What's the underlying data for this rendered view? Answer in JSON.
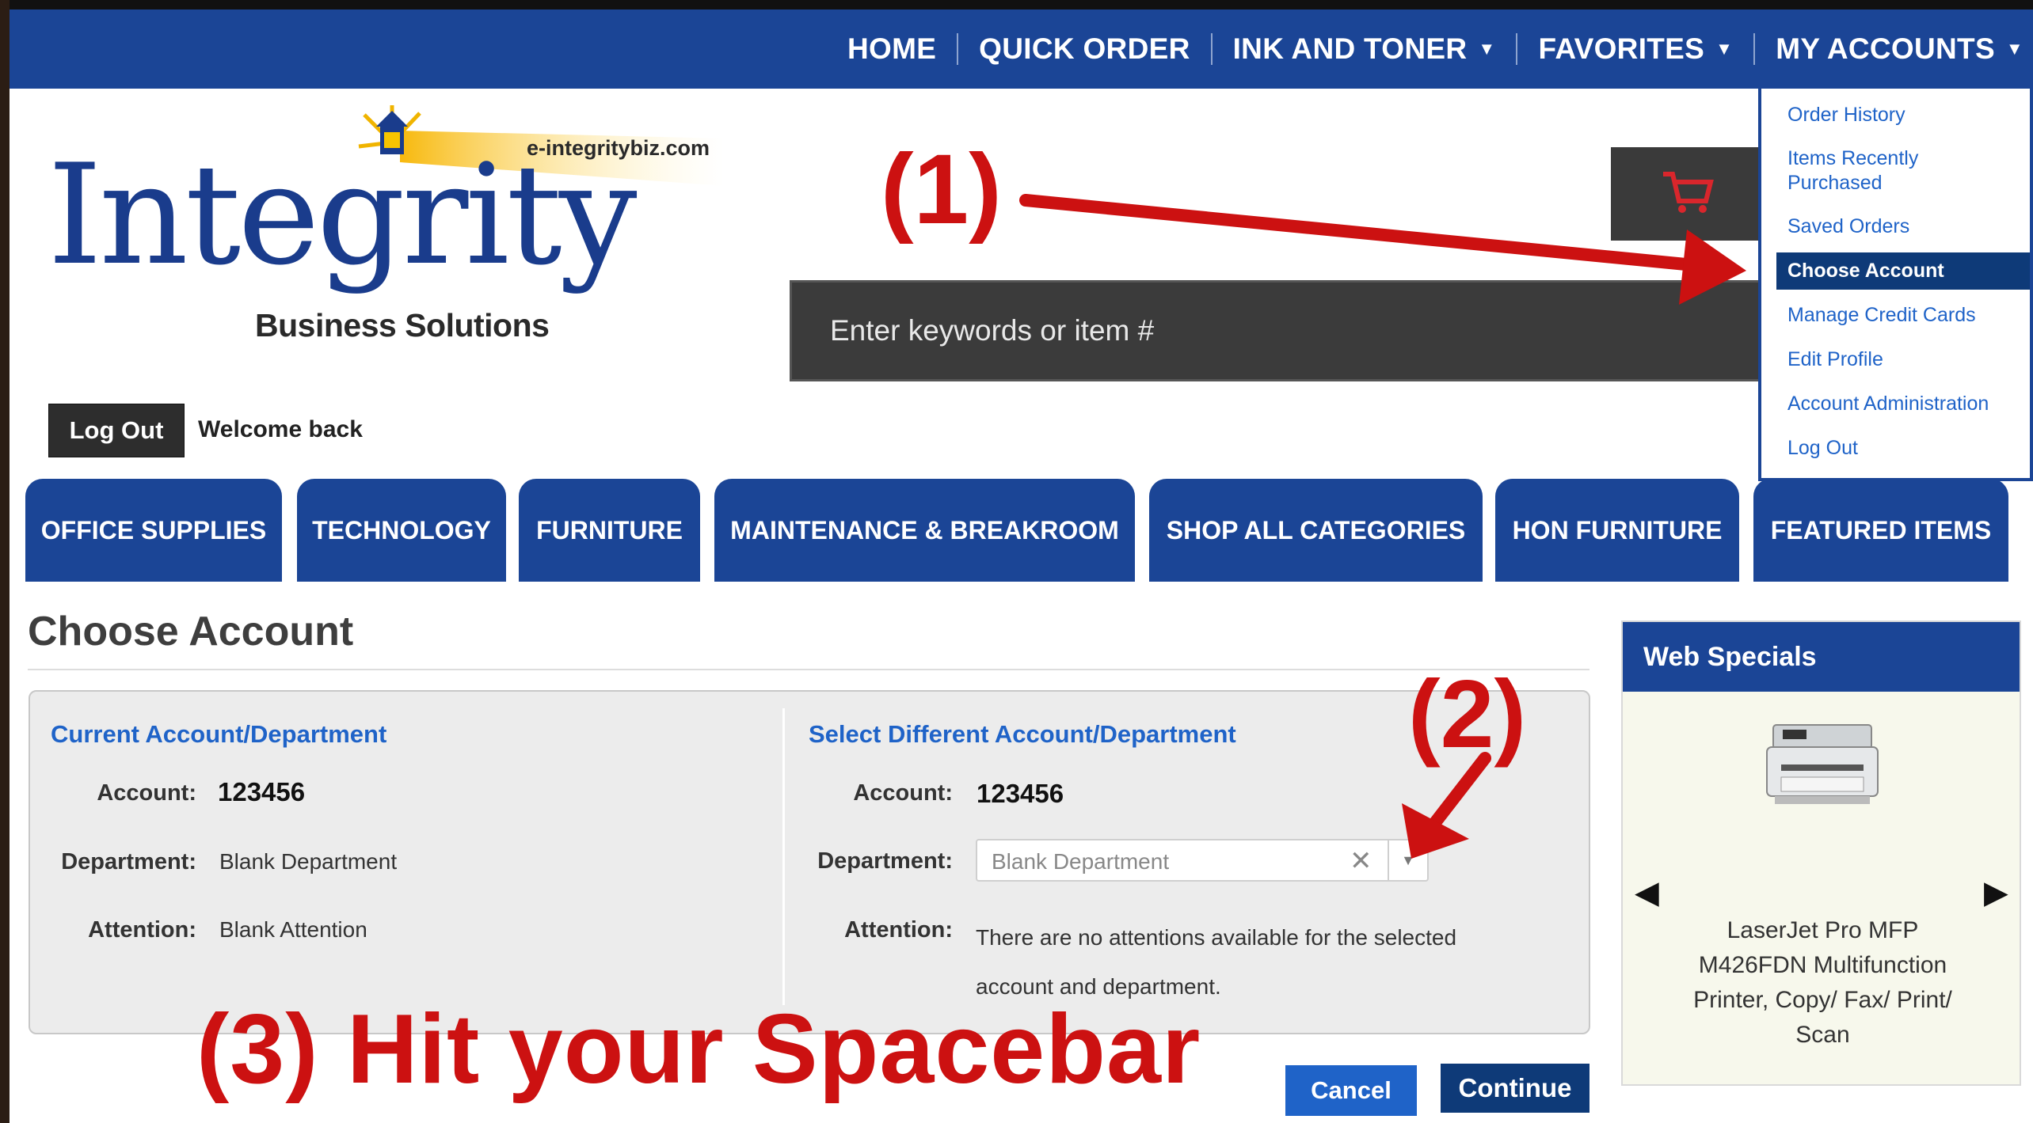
{
  "topnav": {
    "items": [
      {
        "label": "HOME",
        "caret": false
      },
      {
        "label": "QUICK ORDER",
        "caret": false
      },
      {
        "label": "INK AND TONER",
        "caret": true
      },
      {
        "label": "FAVORITES",
        "caret": true
      },
      {
        "label": "MY ACCOUNTS",
        "caret": true
      }
    ]
  },
  "logo": {
    "url": "e-integritybiz.com",
    "word": "Integrity",
    "subtitle": "Business Solutions"
  },
  "search": {
    "placeholder": "Enter keywords or item #"
  },
  "user": {
    "logout_label": "Log Out",
    "welcome": "Welcome back"
  },
  "categories": [
    "OFFICE SUPPLIES",
    "TECHNOLOGY",
    "FURNITURE",
    "MAINTENANCE & BREAKROOM",
    "SHOP ALL CATEGORIES",
    "HON FURNITURE",
    "FEATURED ITEMS"
  ],
  "dropdown": {
    "items": [
      "Order History",
      "Items Recently Purchased",
      "Saved Orders",
      "Choose Account",
      "Manage Credit Cards",
      "Edit Profile",
      "Account Administration",
      "Log Out"
    ],
    "active": "Choose Account"
  },
  "page": {
    "title": "Choose Account",
    "current": {
      "heading": "Current Account/Department",
      "account_label": "Account:",
      "account": "123456",
      "department_label": "Department:",
      "department": "Blank Department",
      "attention_label": "Attention:",
      "attention": "Blank Attention"
    },
    "select": {
      "heading": "Select Different Account/Department",
      "account_label": "Account:",
      "account": "123456",
      "department_label": "Department:",
      "department": "Blank Department",
      "attention_label": "Attention:",
      "attention": "There are no attentions available for the selected account and department."
    },
    "cancel_label": "Cancel",
    "continue_label": "Continue"
  },
  "web_specials": {
    "title": "Web Specials",
    "product": "LaserJet Pro MFP M426FDN Multifunction Printer, Copy/ Fax/ Print/ Scan"
  },
  "annotations": {
    "step1": "(1)",
    "step2": "(2)",
    "step3": "(3) Hit your Spacebar"
  },
  "colors": {
    "brand_blue": "#1b4596",
    "dark_blue": "#0e3a78",
    "link_blue": "#1f63c8",
    "annotation_red": "#cc1111"
  }
}
